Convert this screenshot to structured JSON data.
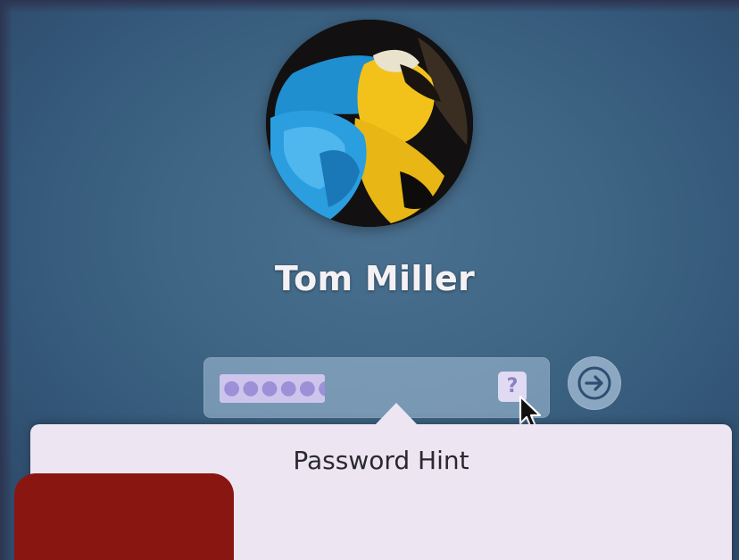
{
  "login": {
    "user_name": "Tom Miller",
    "password_masked": "●●●●●●",
    "hint_button_label": "?",
    "password_hint_title": "Password Hint"
  },
  "icons": {
    "avatar": "parrot-photo",
    "hint": "question-mark-icon",
    "submit": "right-arrow-circle-icon",
    "cursor": "arrow-cursor-icon"
  },
  "colors": {
    "background": "#3e6583",
    "popover": "#eee5f3",
    "redaction": "#8a1612"
  }
}
